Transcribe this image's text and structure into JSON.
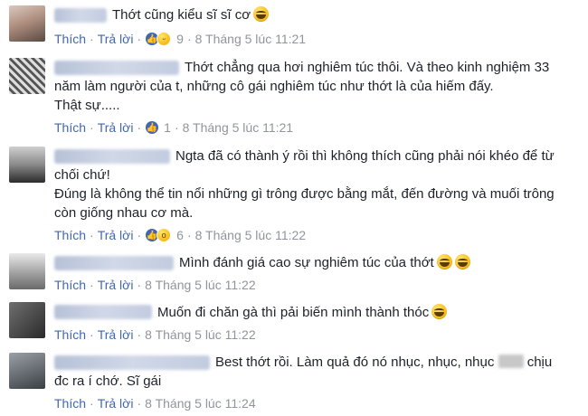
{
  "comments": [
    {
      "text": "Thớt cũng kiểu sĩ sĩ cơ",
      "meta": {
        "like": "Thích",
        "reply": "Trả lời",
        "count": "9",
        "time": "8 Tháng 5 lúc 11:21"
      }
    },
    {
      "text": "Thớt chẳng qua hơi nghiêm túc thôi. Và theo kinh nghiệm 33 năm làm người của t, những cô gái nghiêm túc như thớt là của hiếm đấy.",
      "text2": "Thật sự.....",
      "meta": {
        "like": "Thích",
        "reply": "Trả lời",
        "count": "1",
        "time": "8 Tháng 5 lúc 11:21"
      }
    },
    {
      "text": "Ngta đã có thành ý rồi thì không thích cũng phải nói khéo để từ chối chứ!",
      "text2": "Đúng là không thể tin nổi những gì trông được bằng mắt, đến đường và muối trông còn giống nhau cơ mà.",
      "meta": {
        "like": "Thích",
        "reply": "Trả lời",
        "count": "6",
        "time": "8 Tháng 5 lúc 11:22"
      }
    },
    {
      "text": "Mình đánh giá cao sự nghiêm túc của thớt",
      "meta": {
        "like": "Thích",
        "reply": "Trả lời",
        "time": "8 Tháng 5 lúc 11:22"
      }
    },
    {
      "text": "Muốn đi chăn gà thì pải biến mình thành thóc",
      "meta": {
        "like": "Thích",
        "reply": "Trả lời",
        "time": "8 Tháng 5 lúc 11:22"
      }
    },
    {
      "text_a": "Best thớt rồi. Làm quả đó nó nhục, nhục, nhục",
      "text_b": "chịu đc ra í chớ. Sĩ gái",
      "meta": {
        "like": "Thích",
        "reply": "Trả lời",
        "time": "8 Tháng 5 lúc 11:24"
      }
    }
  ]
}
